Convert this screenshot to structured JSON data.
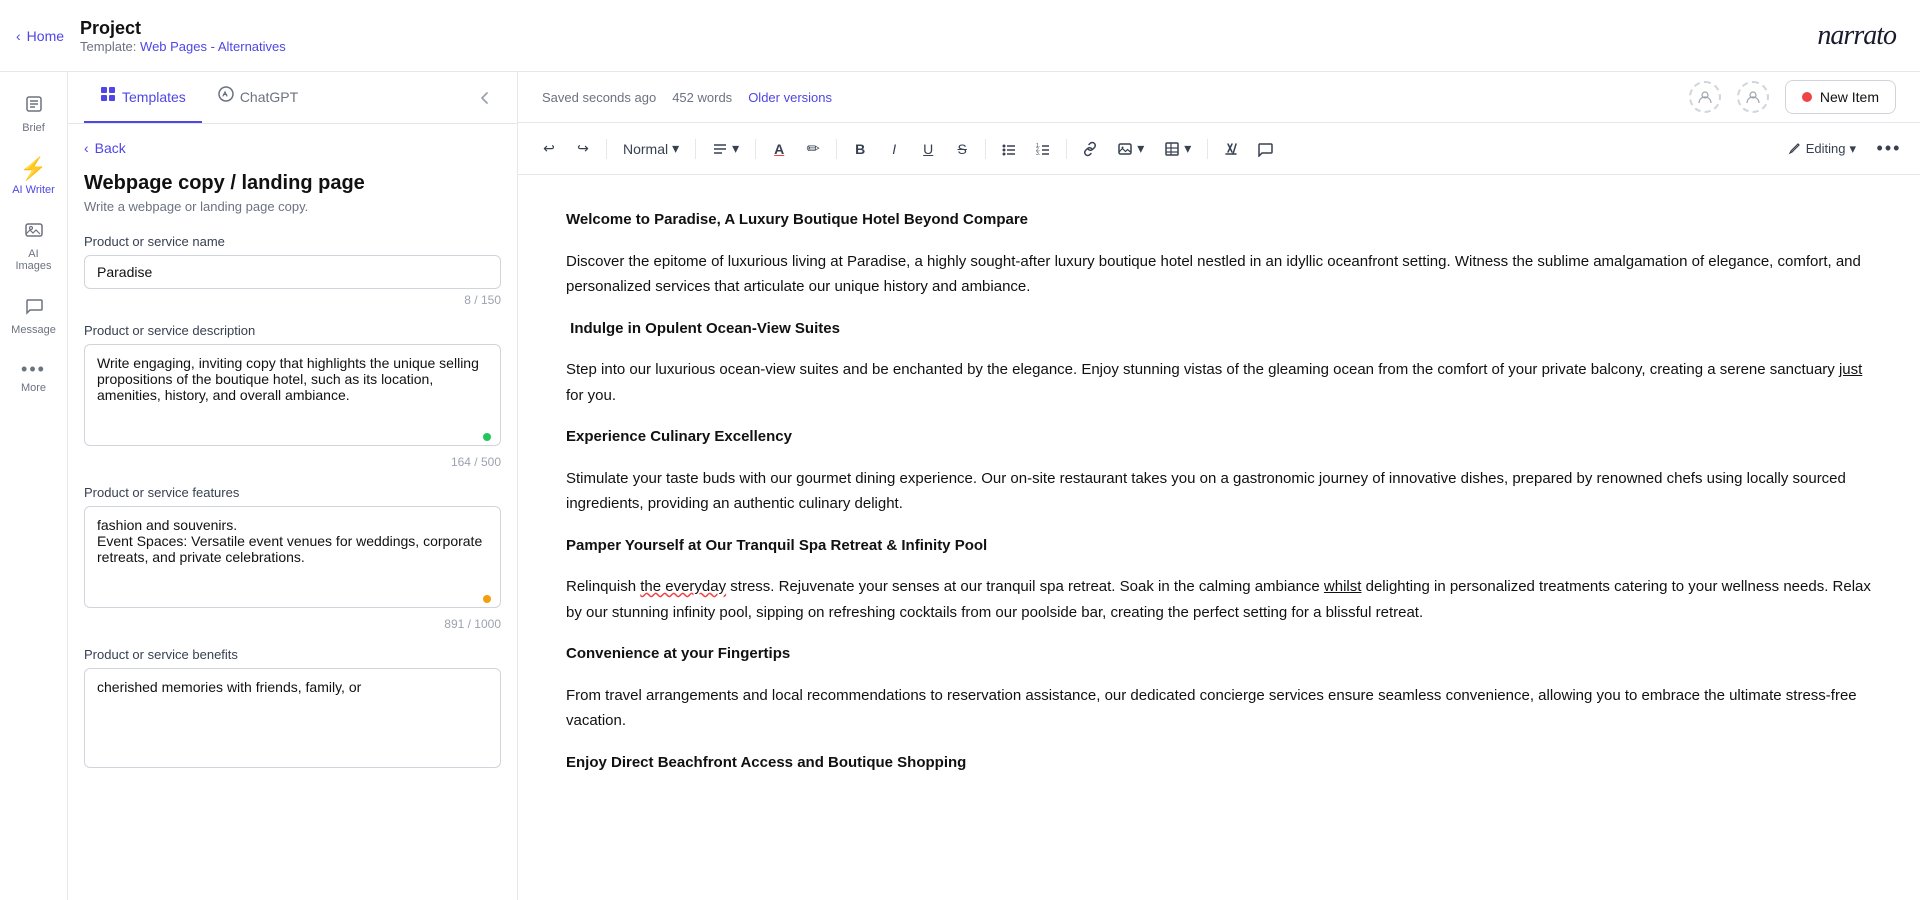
{
  "topbar": {
    "home_label": "Home",
    "project_label": "Project",
    "template_prefix": "Template:",
    "template_link_text": "Web Pages - Alternatives",
    "logo": "narrato"
  },
  "sidebar": {
    "items": [
      {
        "id": "brief",
        "label": "Brief",
        "icon": "⊞",
        "active": false
      },
      {
        "id": "ai-writer",
        "label": "AI Writer",
        "icon": "⚡",
        "active": true
      },
      {
        "id": "ai-images",
        "label": "AI Images",
        "icon": "🖼",
        "active": false
      },
      {
        "id": "message",
        "label": "Message",
        "icon": "💬",
        "active": false
      },
      {
        "id": "more",
        "label": "More",
        "icon": "…",
        "active": false
      }
    ]
  },
  "panel": {
    "tabs": [
      {
        "id": "templates",
        "label": "Templates",
        "icon": "⊞",
        "active": true
      },
      {
        "id": "chatgpt",
        "label": "ChatGPT",
        "icon": "💬",
        "active": false
      }
    ],
    "back_label": "Back",
    "title": "Webpage copy / landing page",
    "subtitle": "Write a webpage or landing page copy.",
    "fields": [
      {
        "id": "product-name",
        "label": "Product or service name",
        "type": "input",
        "value": "Paradise",
        "counter": "8 / 150"
      },
      {
        "id": "product-description",
        "label": "Product or service description",
        "type": "textarea",
        "value": "Write engaging, inviting copy that highlights the unique selling propositions of the boutique hotel, such as its location, amenities, history, and overall ambiance.",
        "counter": "164 / 500",
        "dot": "green"
      },
      {
        "id": "product-features",
        "label": "Product or service features",
        "type": "textarea",
        "value": "fashion and souvenirs.\nEvent Spaces: Versatile event venues for weddings, corporate retreats, and private celebrations.",
        "counter": "891 / 1000",
        "dot": "orange"
      },
      {
        "id": "product-benefits",
        "label": "Product or service benefits",
        "type": "textarea",
        "value": "cherished memories with friends, family, or",
        "counter": "",
        "dot": ""
      }
    ]
  },
  "statusbar": {
    "saved_text": "Saved seconds ago",
    "words": "452 words",
    "older_versions": "Older versions",
    "new_item_label": "New Item"
  },
  "toolbar": {
    "undo": "↩",
    "redo": "↪",
    "style_label": "Normal",
    "align_icon": "≡",
    "text_color_icon": "A",
    "highlight_icon": "✏",
    "bold": "B",
    "italic": "I",
    "underline": "U",
    "strikethrough": "S",
    "bullet_list": "≡",
    "ordered_list": "≡",
    "link": "🔗",
    "image": "🖼",
    "table": "⊞",
    "no_format": "⌧",
    "comment": "💬",
    "editing_label": "Editing",
    "more_options": "…"
  },
  "editor": {
    "content": [
      {
        "type": "heading",
        "text": "**Welcome to Paradise, A Luxury Boutique Hotel Beyond Compare**"
      },
      {
        "type": "paragraph",
        "text": "Discover the epitome of luxurious living at Paradise, a highly sought-after luxury boutique hotel nestled in an idyllic oceanfront setting. Witness the sublime amalgamation of elegance, comfort, and personalized services that articulate our unique history and ambiance."
      },
      {
        "type": "heading",
        "text": " **Indulge in Opulent Ocean-View Suites**"
      },
      {
        "type": "paragraph",
        "text": "Step into our luxurious ocean-view suites and be enchanted by the elegance. Enjoy stunning vistas of the gleaming ocean from the comfort of your private balcony, creating a serene sanctuary just for you."
      },
      {
        "type": "heading",
        "text": "**Experience Culinary Excellency**"
      },
      {
        "type": "paragraph",
        "text": "Stimulate your taste buds with our gourmet dining experience. Our on-site restaurant takes you on a gastronomic journey of innovative dishes, prepared by renowned chefs using locally sourced ingredients, providing an authentic culinary delight."
      },
      {
        "type": "heading",
        "text": "**Pamper Yourself at Our Tranquil Spa Retreat & Infinity Pool**"
      },
      {
        "type": "paragraph",
        "text": "Relinquish the everyday stress. Rejuvenate your senses at our tranquil spa retreat. Soak in the calming ambiance whilst delighting in personalized treatments catering to your wellness needs. Relax by our stunning infinity pool, sipping on refreshing cocktails from our poolside bar, creating the perfect setting for a blissful retreat."
      },
      {
        "type": "heading",
        "text": "**Convenience at your Fingertips**"
      },
      {
        "type": "paragraph",
        "text": "From travel arrangements and local recommendations to reservation assistance, our dedicated concierge services ensure seamless convenience, allowing you to embrace the ultimate stress-free vacation."
      },
      {
        "type": "heading",
        "text": "**Enjoy Direct Beachfront Access and Boutique Shopping**"
      }
    ]
  }
}
